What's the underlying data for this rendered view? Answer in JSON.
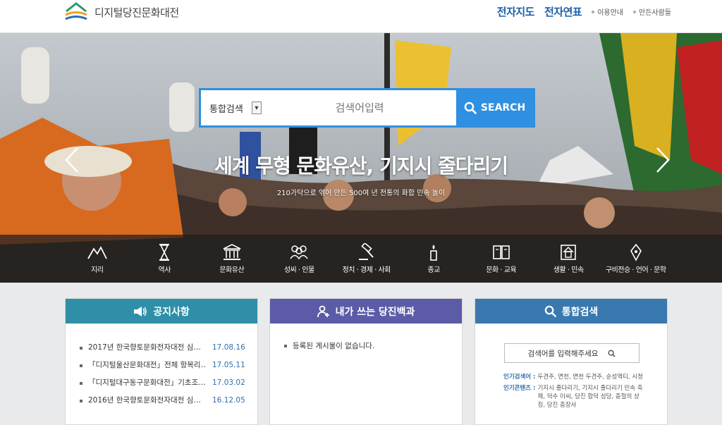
{
  "header": {
    "logo_text": "디지털당진문화대전",
    "nav": [
      {
        "label": "전자지도",
        "type": "big"
      },
      {
        "label": "전자연표",
        "type": "big"
      },
      {
        "label": "이용안내",
        "type": "small"
      },
      {
        "label": "만든사람들",
        "type": "small"
      }
    ]
  },
  "search": {
    "select_value": "통합검색",
    "placeholder": "검색어입력",
    "button_label": "SEARCH"
  },
  "hero": {
    "title": "세계 무형 문화유산, 기지시 줄다리기",
    "subtitle": "210가닥으로 엮어 만든 500여 년 전통의 화합 민속 놀이"
  },
  "categories": [
    {
      "label": "지리",
      "icon": "mountain-icon"
    },
    {
      "label": "역사",
      "icon": "hourglass-icon"
    },
    {
      "label": "문화유산",
      "icon": "temple-icon"
    },
    {
      "label": "성씨 · 인물",
      "icon": "people-icon"
    },
    {
      "label": "정치 · 경제 · 사회",
      "icon": "gavel-icon"
    },
    {
      "label": "종교",
      "icon": "candle-icon"
    },
    {
      "label": "문화 · 교육",
      "icon": "book-icon"
    },
    {
      "label": "생활 · 민속",
      "icon": "house-icon"
    },
    {
      "label": "구비전승 · 언어 · 문학",
      "icon": "pen-icon"
    }
  ],
  "notice": {
    "title": "공지사항",
    "items": [
      {
        "text": "2017년 한국향토문화전자대전 심…",
        "date": "17.08.16"
      },
      {
        "text": "「디지털울산문화대전」전체 항목리…",
        "date": "17.05.11"
      },
      {
        "text": "「디지털대구동구문화대전」기초조…",
        "date": "17.03.02"
      },
      {
        "text": "2016년 한국향토문화전자대전 심…",
        "date": "16.12.05"
      }
    ]
  },
  "wiki": {
    "title": "내가 쓰는 당진백과",
    "empty_text": "등록된 게시물이 없습니다."
  },
  "integrated": {
    "title": "통합검색",
    "placeholder": "검색어를 입력해주세요",
    "popular_label": "인기검색어 :",
    "popular_text": "두견주, 면천, 면천 두견주, 순성역티, 시청",
    "content_label": "인기콘텐츠 :",
    "content_text": "기지시 줄다리기, 기지시 줄다리기 민속 축제, 덕수 이씨, 당진 합덕 성당, 충절의 상징, 당진 충장사"
  },
  "colors": {
    "search_blue": "#2f8fe0",
    "notice_head": "#2f8fa8",
    "wiki_head": "#5b5ba8",
    "search_head": "#3a78b0",
    "nav_blue": "#1a5fa8"
  }
}
